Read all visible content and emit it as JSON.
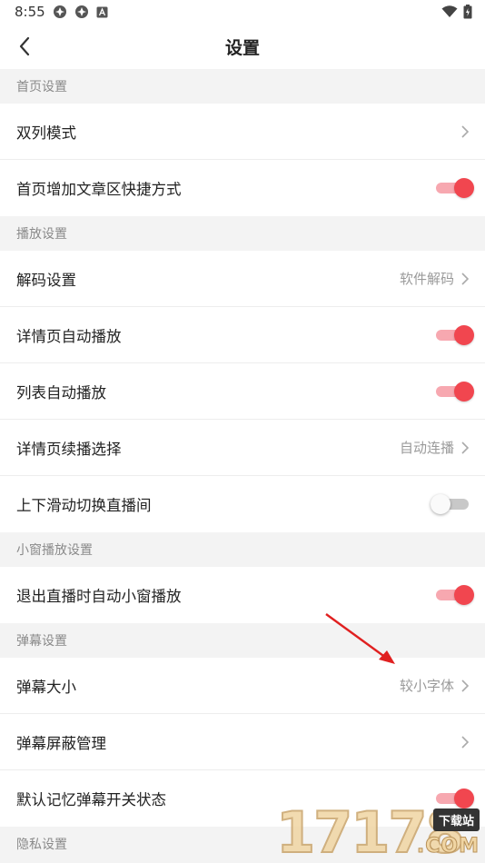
{
  "status_bar": {
    "time": "8:55"
  },
  "header": {
    "title": "设置"
  },
  "sections": {
    "home": {
      "title": "首页设置",
      "double_column": {
        "label": "双列模式"
      },
      "add_shortcut": {
        "label": "首页增加文章区快捷方式",
        "on": true
      }
    },
    "playback": {
      "title": "播放设置",
      "decode": {
        "label": "解码设置",
        "value": "软件解码"
      },
      "detail_autoplay": {
        "label": "详情页自动播放",
        "on": true
      },
      "list_autoplay": {
        "label": "列表自动播放",
        "on": true
      },
      "detail_continue": {
        "label": "详情页续播选择",
        "value": "自动连播"
      },
      "swipe_switch": {
        "label": "上下滑动切换直播间",
        "on": false
      }
    },
    "mini_window": {
      "title": "小窗播放设置",
      "exit_live_mini": {
        "label": "退出直播时自动小窗播放",
        "on": true
      }
    },
    "danmaku": {
      "title": "弹幕设置",
      "size": {
        "label": "弹幕大小",
        "value": "较小字体"
      },
      "block_manage": {
        "label": "弹幕屏蔽管理"
      },
      "remember_state": {
        "label": "默认记忆弹幕开关状态",
        "on": true
      }
    },
    "privacy": {
      "title": "隐私设置"
    }
  },
  "watermark": {
    "digits": "17178",
    "badge": "下载站",
    "suffix": ".COM"
  },
  "colors": {
    "accent": "#f1464f",
    "accent_track": "#f7a8b0",
    "section_bg": "#f3f3f3"
  },
  "icons": {
    "back": "chevron-left-icon",
    "chevron": "chevron-right-icon",
    "wifi": "wifi-icon",
    "battery": "battery-icon"
  }
}
